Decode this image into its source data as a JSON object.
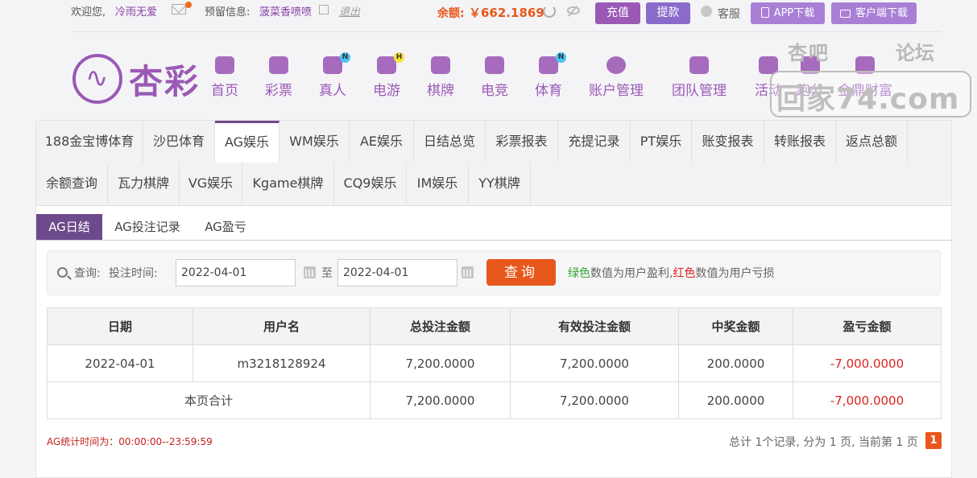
{
  "topbar": {
    "welcome": "欢迎您,",
    "username": "冷雨无爱",
    "reserve_label": "预留信息:",
    "reserve_value": "菠菜香喷喷",
    "logout": "退出",
    "balance_label": "余额:",
    "balance_value": "￥662.1869",
    "recharge": "充值",
    "withdraw": "提款",
    "service": "客服",
    "app_download": "APP下载",
    "client_download": "客户端下载"
  },
  "brand": {
    "logo_text": "杏彩",
    "accent": "#9b59b6",
    "orange": "#e8571c"
  },
  "nav": [
    {
      "label": "首页",
      "icon": "home-icon"
    },
    {
      "label": "彩票",
      "icon": "lottery-ticket-icon"
    },
    {
      "label": "真人",
      "icon": "dealer-icon",
      "badge": "N"
    },
    {
      "label": "电游",
      "icon": "gamepad-icon",
      "badge": "H"
    },
    {
      "label": "棋牌",
      "icon": "cards-icon"
    },
    {
      "label": "电竞",
      "icon": "esports-controller-icon"
    },
    {
      "label": "体育",
      "icon": "trophy-icon",
      "badge": "N"
    },
    {
      "label": "账户管理",
      "icon": "yen-coin-icon"
    },
    {
      "label": "团队管理",
      "icon": "team-icon"
    },
    {
      "label": "活动",
      "icon": "gift-icon"
    },
    {
      "label": "跑分",
      "icon": "run-score-icon"
    },
    {
      "label": "金鼎财富",
      "icon": "wealth-icon"
    }
  ],
  "watermark": {
    "line1": "杏吧",
    "line1b": "论坛",
    "line2": "回家74.com"
  },
  "tabs": [
    "188金宝博体育",
    "沙巴体育",
    "AG娱乐",
    "WM娱乐",
    "AE娱乐",
    "日结总览",
    "彩票报表",
    "充提记录",
    "PT娱乐",
    "账变报表",
    "转账报表",
    "返点总额",
    "余额查询",
    "瓦力棋牌",
    "VG娱乐",
    "Kgame棋牌",
    "CQ9娱乐",
    "IM娱乐",
    "YY棋牌"
  ],
  "active_tab": "AG娱乐",
  "subtabs": [
    "AG日结",
    "AG投注记录",
    "AG盈亏"
  ],
  "filter": {
    "query_label": "查询:",
    "bet_time_label": "投注时间:",
    "start_date": "2022-04-01",
    "to_label": "至",
    "end_date": "2022-04-01",
    "query_button": "查询",
    "legend_green": "绿色",
    "legend_mid": "数值为用户盈利,",
    "legend_red": "红色",
    "legend_end": "数值为用户亏损"
  },
  "table": {
    "headers": [
      "日期",
      "用户名",
      "总投注金额",
      "有效投注金额",
      "中奖金额",
      "盈亏金额"
    ],
    "rows": [
      [
        "2022-04-01",
        "m3218128924",
        "7,200.0000",
        "7,200.0000",
        "200.0000",
        "-7,000.0000"
      ]
    ],
    "total_label": "本页合计",
    "total_row": [
      "7,200.0000",
      "7,200.0000",
      "200.0000",
      "-7,000.0000"
    ]
  },
  "footer": {
    "stat_time": "AG统计时间为：00:00:00--23:59:59",
    "pager_info": "总计 1个记录, 分为 1 页, 当前第 1 页",
    "current_page": "1"
  }
}
